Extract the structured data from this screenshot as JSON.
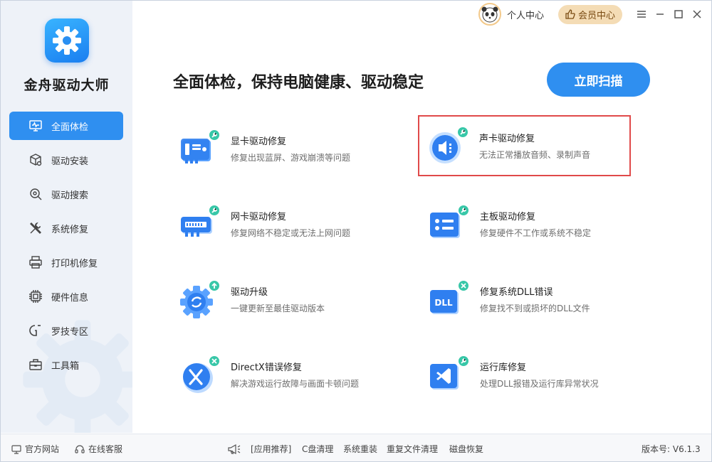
{
  "app": {
    "name": "金舟驱动大师"
  },
  "topbar": {
    "personal_center": "个人中心",
    "vip_center": "会员中心"
  },
  "sidebar": {
    "items": [
      {
        "label": "全面体检",
        "icon": "monitor-check-icon",
        "active": true
      },
      {
        "label": "驱动安装",
        "icon": "box-gear-icon",
        "active": false
      },
      {
        "label": "驱动搜索",
        "icon": "search-gear-icon",
        "active": false
      },
      {
        "label": "系统修复",
        "icon": "wrench-screwdriver-icon",
        "active": false
      },
      {
        "label": "打印机修复",
        "icon": "printer-icon",
        "active": false
      },
      {
        "label": "硬件信息",
        "icon": "chip-icon",
        "active": false
      },
      {
        "label": "罗技专区",
        "icon": "logitech-icon",
        "active": false
      },
      {
        "label": "工具箱",
        "icon": "toolbox-icon",
        "active": false
      }
    ]
  },
  "main": {
    "headline": "全面体检，保持电脑健康、驱动稳定",
    "scan_button": "立即扫描",
    "cards": [
      {
        "title": "显卡驱动修复",
        "desc": "修复出现蓝屏、游戏崩溃等问题",
        "icon": "graphics-card-icon"
      },
      {
        "title": "声卡驱动修复",
        "desc": "无法正常播放音频、录制声音",
        "icon": "sound-card-icon"
      },
      {
        "title": "网卡驱动修复",
        "desc": "修复网络不稳定或无法上网问题",
        "icon": "network-card-icon"
      },
      {
        "title": "主板驱动修复",
        "desc": "修复硬件不工作或系统不稳定",
        "icon": "motherboard-icon"
      },
      {
        "title": "驱动升级",
        "desc": "一键更新至最佳驱动版本",
        "icon": "driver-upgrade-icon"
      },
      {
        "title": "修复系统DLL错误",
        "desc": "修复找不到或损坏的DLL文件",
        "icon": "dll-icon"
      },
      {
        "title": "DirectX错误修复",
        "desc": "解决游戏运行故障与画面卡顿问题",
        "icon": "directx-icon"
      },
      {
        "title": "运行库修复",
        "desc": "处理DLL报错及运行库异常状况",
        "icon": "runtime-library-icon"
      }
    ]
  },
  "footer": {
    "official_site": "官方网站",
    "online_service": "在线客服",
    "recommend": "[应用推荐]",
    "links": [
      "C盘清理",
      "系统重装",
      "重复文件清理",
      "磁盘恢复"
    ],
    "version": "版本号:  V6.1.3"
  },
  "colors": {
    "accent": "#2f8ff0",
    "badge": "#38c7a8",
    "vip_bg": "#f4dcb5",
    "highlight_border": "#e04a4a"
  }
}
